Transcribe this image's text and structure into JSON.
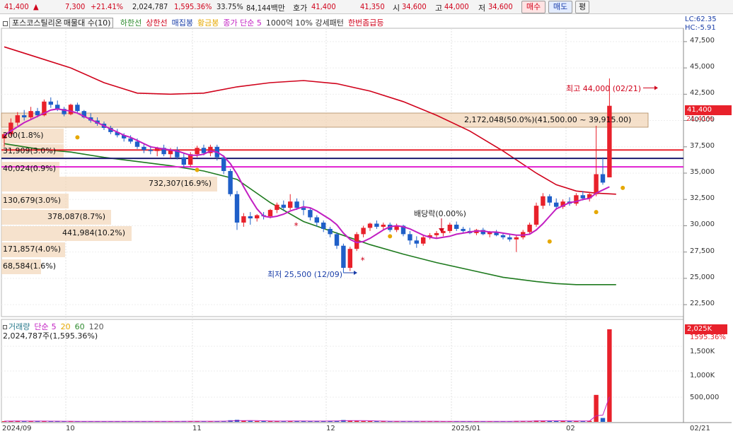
{
  "topbar": {
    "price": "41,400",
    "change_arrow": "▲",
    "change": "7,300",
    "change_pct": "+21.41%",
    "volume": "2,024,787",
    "volume_ratio": "1,595.36%",
    "turnover": "33.75%",
    "amount": "84,144백만",
    "quote_label": "호가",
    "ask": "41,400",
    "bid": "41,350",
    "open_label": "시",
    "open": "34,600",
    "high_label": "고",
    "high": "44,000",
    "low_label": "저",
    "low": "34,600",
    "buy_label": "매수",
    "sell_label": "매도",
    "eq_label": "평"
  },
  "legend": {
    "stock_name": "포스코스틸리온",
    "series_label": "매물대 수(10)",
    "items": [
      {
        "label": "하한선",
        "color": "#2e8b2e"
      },
      {
        "label": "상한선",
        "color": "#d0021b"
      },
      {
        "label": "매집봉",
        "color": "#1a3ea8"
      },
      {
        "label": "황금봉",
        "color": "#e6a800"
      },
      {
        "label": "종가 단순 5",
        "color": "#c21fc2"
      },
      {
        "label": "1000억 10% 강세패턴",
        "color": "#333333"
      },
      {
        "label": "한번좀급등",
        "color": "#d0021b"
      }
    ]
  },
  "right_info": {
    "lc": "LC:62.35",
    "hc": "HC:-5.91"
  },
  "price_axis": [
    "47,500",
    "45,000",
    "42,500",
    "40,000",
    "37,500",
    "35,000",
    "32,500",
    "30,000",
    "27,500",
    "25,000",
    "22,500"
  ],
  "current_price_tag": "41,400",
  "current_pct_tag": "21.41%",
  "volume_profile": [
    {
      "label": "2,172,048(50.0%)(41,500.00 ~ 39,915.00)"
    },
    {
      "label": "200(1.8%)"
    },
    {
      "label": "31,909(3.0%)"
    },
    {
      "label": "40,024(0.9%)"
    },
    {
      "label": "732,307(16.9%)"
    },
    {
      "label": "130,679(3.0%)"
    },
    {
      "label": "378,087(8.7%)"
    },
    {
      "label": "441,984(10.2%)"
    },
    {
      "label": "171,857(4.0%)"
    },
    {
      "label": "68,584(1.6%)"
    }
  ],
  "annotations": {
    "high": "최고 44,000 (02/21)",
    "low": "최저 25,500 (12/09)",
    "dividend": "배당락(0.00%)"
  },
  "volume_panel": {
    "legend_label": "거래량",
    "ma_label": "단순",
    "ma_periods": [
      "5",
      "20",
      "60",
      "120"
    ],
    "ma_colors": [
      "#c21fc2",
      "#e6a800",
      "#2e8b2e",
      "#555555"
    ],
    "current_text": "2,024,787주(1,595.36%)",
    "axis": [
      "1,500K",
      "1,000K",
      "500,000"
    ],
    "tag_value": "2,025K",
    "tag_pct": "1595.36%"
  },
  "x_axis": [
    "2024/09",
    "10",
    "11",
    "12",
    "2025/01",
    "02",
    "02/21"
  ],
  "chart_data": {
    "type": "candlestick",
    "ylim": [
      21500,
      48500
    ],
    "up_color": "#e8212b",
    "down_color": "#1f5fc8",
    "candles": [
      [
        38300,
        38800,
        37500,
        38700
      ],
      [
        38700,
        40200,
        38500,
        39800
      ],
      [
        39800,
        40800,
        39500,
        40500
      ],
      [
        40500,
        41000,
        40000,
        40300
      ],
      [
        40300,
        41300,
        40100,
        40900
      ],
      [
        40900,
        41200,
        40300,
        40500
      ],
      [
        40500,
        42000,
        40400,
        41800
      ],
      [
        41800,
        42200,
        41200,
        41500
      ],
      [
        41500,
        41900,
        40900,
        41100
      ],
      [
        41100,
        41300,
        40400,
        40600
      ],
      [
        40600,
        41600,
        40500,
        41500
      ],
      [
        41500,
        41700,
        40700,
        40900
      ],
      [
        40900,
        41000,
        40200,
        40300
      ],
      [
        40300,
        40700,
        39800,
        40000
      ],
      [
        40000,
        40300,
        39500,
        39700
      ],
      [
        39700,
        39900,
        39100,
        39300
      ],
      [
        39300,
        39500,
        38700,
        38900
      ],
      [
        38900,
        39200,
        38400,
        38600
      ],
      [
        38600,
        38800,
        38000,
        38300
      ],
      [
        38300,
        38600,
        37800,
        38000
      ],
      [
        38000,
        38300,
        37300,
        37500
      ],
      [
        37500,
        37800,
        36900,
        37200
      ],
      [
        37200,
        37600,
        36800,
        37100
      ],
      [
        37100,
        37500,
        36600,
        37400
      ],
      [
        37400,
        37700,
        36600,
        36800
      ],
      [
        36800,
        37400,
        36400,
        37200
      ],
      [
        37200,
        37500,
        36300,
        36500
      ],
      [
        36500,
        36900,
        35500,
        35800
      ],
      [
        35800,
        37000,
        35600,
        36800
      ],
      [
        36800,
        37600,
        36500,
        37400
      ],
      [
        37400,
        37700,
        36700,
        36900
      ],
      [
        36900,
        37700,
        36600,
        37500
      ],
      [
        37500,
        37700,
        36200,
        36500
      ],
      [
        36500,
        36700,
        34900,
        35200
      ],
      [
        35200,
        35400,
        32800,
        33000
      ],
      [
        33000,
        33300,
        29600,
        30300
      ],
      [
        30300,
        31200,
        29900,
        30900
      ],
      [
        30900,
        31300,
        30100,
        30700
      ],
      [
        30700,
        31100,
        30400,
        31000
      ],
      [
        31000,
        31300,
        30600,
        30900
      ],
      [
        30900,
        31600,
        30700,
        31500
      ],
      [
        31500,
        32200,
        31200,
        32000
      ],
      [
        32000,
        32400,
        31400,
        31700
      ],
      [
        31700,
        33000,
        31500,
        32300
      ],
      [
        32300,
        32600,
        31500,
        31700
      ],
      [
        31700,
        32400,
        31000,
        31500
      ],
      [
        31500,
        31700,
        30500,
        30800
      ],
      [
        30800,
        31000,
        29900,
        30300
      ],
      [
        30300,
        30500,
        29400,
        29700
      ],
      [
        29700,
        29900,
        28900,
        29200
      ],
      [
        29200,
        29400,
        27800,
        28100
      ],
      [
        28100,
        28300,
        25500,
        26000
      ],
      [
        26000,
        28000,
        25700,
        27800
      ],
      [
        27800,
        29400,
        27600,
        29200
      ],
      [
        29200,
        30000,
        28900,
        29800
      ],
      [
        29800,
        30300,
        29500,
        30200
      ],
      [
        30200,
        30500,
        29700,
        29900
      ],
      [
        29900,
        30300,
        29600,
        30100
      ],
      [
        30100,
        30300,
        29400,
        29600
      ],
      [
        29600,
        30200,
        29400,
        30000
      ],
      [
        30000,
        30100,
        29000,
        29200
      ],
      [
        29200,
        29500,
        28200,
        28600
      ],
      [
        28600,
        29000,
        27900,
        28300
      ],
      [
        28300,
        29100,
        28100,
        28900
      ],
      [
        28900,
        29300,
        28700,
        29100
      ],
      [
        29100,
        29500,
        28800,
        29300
      ],
      [
        29300,
        29700,
        29000,
        29500
      ],
      [
        29500,
        30300,
        29300,
        30100
      ],
      [
        30100,
        30400,
        29500,
        29700
      ],
      [
        29700,
        29900,
        29300,
        29500
      ],
      [
        29500,
        29800,
        29200,
        29300
      ],
      [
        29300,
        29700,
        29100,
        29600
      ],
      [
        29600,
        29800,
        29100,
        29200
      ],
      [
        29200,
        29500,
        28900,
        29400
      ],
      [
        29400,
        29600,
        29000,
        29100
      ],
      [
        29100,
        29300,
        28700,
        28900
      ],
      [
        28900,
        29200,
        28500,
        28700
      ],
      [
        28700,
        29100,
        27500,
        28900
      ],
      [
        28900,
        29600,
        28700,
        29400
      ],
      [
        29400,
        30300,
        29200,
        30100
      ],
      [
        30100,
        32200,
        29900,
        31900
      ],
      [
        31900,
        33100,
        31600,
        32800
      ],
      [
        32800,
        33000,
        31900,
        32200
      ],
      [
        32200,
        32600,
        31500,
        31800
      ],
      [
        31800,
        32500,
        31600,
        32300
      ],
      [
        32300,
        32700,
        31900,
        32100
      ],
      [
        32100,
        33100,
        31900,
        32900
      ],
      [
        32900,
        33300,
        32400,
        32600
      ],
      [
        32600,
        33200,
        32300,
        33000
      ],
      [
        33000,
        39500,
        32800,
        34900
      ],
      [
        34900,
        36500,
        33900,
        34100
      ],
      [
        34600,
        44000,
        34600,
        41400
      ]
    ],
    "ma5": [
      38600,
      39000,
      39400,
      39800,
      40100,
      40400,
      40700,
      41000,
      41100,
      41000,
      40900,
      40700,
      40400,
      40100,
      39800,
      39500,
      39200,
      38900,
      38600,
      38400,
      38100,
      37800,
      37500,
      37400,
      37300,
      37200,
      37100,
      36900,
      36700,
      36700,
      36800,
      37100,
      37000,
      36600,
      35900,
      34900,
      33700,
      32600,
      31600,
      30900,
      30800,
      30900,
      31100,
      31400,
      31600,
      31800,
      31700,
      31400,
      31000,
      30600,
      30100,
      29300,
      28700,
      28400,
      28500,
      28800,
      29200,
      29600,
      29900,
      30000,
      29900,
      29700,
      29400,
      29100,
      28900,
      28800,
      28900,
      29000,
      29200,
      29300,
      29400,
      29500,
      29500,
      29400,
      29400,
      29300,
      29200,
      29100,
      29100,
      29200,
      29600,
      30200,
      30900,
      31600,
      31900,
      32200,
      32300,
      32500,
      32600,
      33100,
      33400,
      33700
    ],
    "upper_band": [
      [
        0,
        47000
      ],
      [
        5,
        46000
      ],
      [
        10,
        45000
      ],
      [
        15,
        43600
      ],
      [
        20,
        42600
      ],
      [
        25,
        42500
      ],
      [
        30,
        42600
      ],
      [
        35,
        43200
      ],
      [
        40,
        43600
      ],
      [
        45,
        43800
      ],
      [
        50,
        43500
      ],
      [
        55,
        42800
      ],
      [
        60,
        41800
      ],
      [
        65,
        40500
      ],
      [
        70,
        39000
      ],
      [
        75,
        37100
      ],
      [
        80,
        35000
      ],
      [
        83,
        33900
      ],
      [
        86,
        33300
      ],
      [
        89,
        33100
      ],
      [
        92,
        33000
      ]
    ],
    "lower_band": [
      [
        0,
        37800
      ],
      [
        5,
        37300
      ],
      [
        10,
        37000
      ],
      [
        15,
        36500
      ],
      [
        20,
        36100
      ],
      [
        25,
        35700
      ],
      [
        30,
        35200
      ],
      [
        35,
        34400
      ],
      [
        40,
        32200
      ],
      [
        45,
        30400
      ],
      [
        50,
        29300
      ],
      [
        55,
        28200
      ],
      [
        60,
        27300
      ],
      [
        65,
        26500
      ],
      [
        70,
        25800
      ],
      [
        75,
        25100
      ],
      [
        80,
        24700
      ],
      [
        83,
        24500
      ],
      [
        86,
        24400
      ],
      [
        89,
        24400
      ],
      [
        92,
        24400
      ]
    ],
    "volumes": [
      15000,
      18000,
      22000,
      16000,
      14000,
      12000,
      20000,
      15000,
      13000,
      11000,
      14000,
      12000,
      11000,
      10000,
      12000,
      11000,
      10000,
      9000,
      11000,
      10000,
      12000,
      11000,
      10000,
      13000,
      11000,
      12000,
      10000,
      18000,
      16000,
      14000,
      12000,
      13000,
      15000,
      20000,
      35000,
      45000,
      25000,
      20000,
      15000,
      14000,
      16000,
      20000,
      18000,
      22000,
      17000,
      15000,
      16000,
      18000,
      20000,
      22000,
      25000,
      40000,
      30000,
      22000,
      18000,
      15000,
      14000,
      13000,
      12000,
      13000,
      14000,
      16000,
      15000,
      13000,
      12000,
      11000,
      12000,
      15000,
      14000,
      12000,
      11000,
      12000,
      11000,
      12000,
      11000,
      13000,
      14000,
      20000,
      16000,
      18000,
      30000,
      28000,
      22000,
      20000,
      18000,
      17000,
      22000,
      20000,
      22000,
      590000,
      85000,
      2024787
    ]
  }
}
